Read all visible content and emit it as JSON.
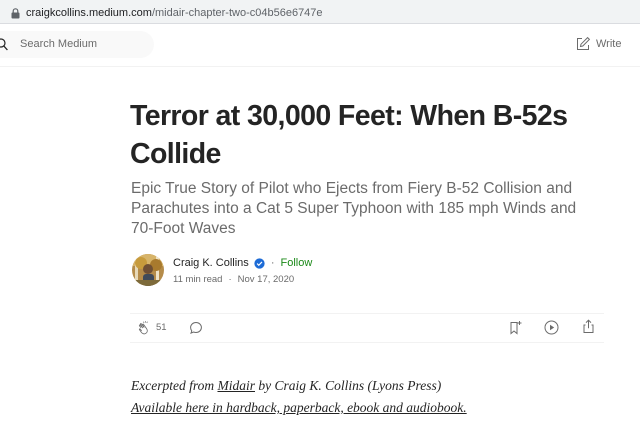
{
  "browser": {
    "url_domain": "craigkcollins.medium.com",
    "url_path": "/midair-chapter-two-c04b56e6747e"
  },
  "header": {
    "search_placeholder": "Search Medium",
    "write_label": "Write"
  },
  "article": {
    "title": "Terror at 30,000 Feet: When B-52s Collide",
    "subtitle": "Epic True Story of Pilot who Ejects from Fiery B-52 Collision and Parachutes into a Cat 5 Super Typhoon with 185 mph Winds and 70-Foot Waves",
    "author": {
      "name": "Craig K. Collins",
      "separator": "·",
      "follow_label": "Follow",
      "read_time": "11 min read",
      "meta_separator": "·",
      "date": "Nov 17, 2020"
    },
    "actions": {
      "clap_count": "51"
    },
    "excerpt": {
      "prefix": "Excerpted from ",
      "book_link": "Midair",
      "suffix": " by Craig K. Collins (Lyons Press)",
      "availability_link": "Available here in hardback, paperback, ebook and audiobook."
    }
  },
  "colors": {
    "follow": "#1a8917",
    "verified_badge": "#1d6bd6",
    "text_primary": "#242424",
    "text_secondary": "#6b6b6b"
  },
  "icons": [
    "lock-icon",
    "search-icon",
    "write-icon",
    "verified-badge-icon",
    "clap-icon",
    "response-icon",
    "bookmark-icon",
    "listen-icon",
    "share-icon"
  ]
}
